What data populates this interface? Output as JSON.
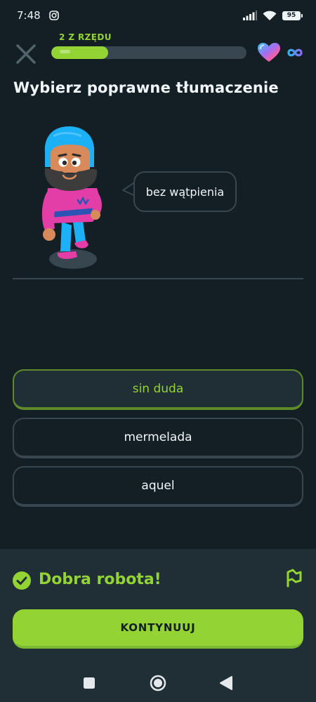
{
  "status_bar": {
    "time": "7:48",
    "battery": "95",
    "icons": [
      "instagram-icon",
      "signal-icon",
      "wifi-icon",
      "battery-icon"
    ]
  },
  "header": {
    "streak_label": "2 Z RZĘDU",
    "progress": 0.29,
    "hearts": "infinity"
  },
  "lesson": {
    "title": "Wybierz poprawne tłumaczenie",
    "prompt": "bez wątpienia"
  },
  "answers": [
    {
      "label": "sin duda",
      "selected": true
    },
    {
      "label": "mermelada",
      "selected": false
    },
    {
      "label": "aquel",
      "selected": false
    }
  ],
  "feedback": {
    "message": "Dobra robota!",
    "continue_label": "KONTYNUUJ"
  },
  "colors": {
    "background": "#131f24",
    "panel": "#202f36",
    "accent_green": "#93d333",
    "border": "#37464f"
  }
}
